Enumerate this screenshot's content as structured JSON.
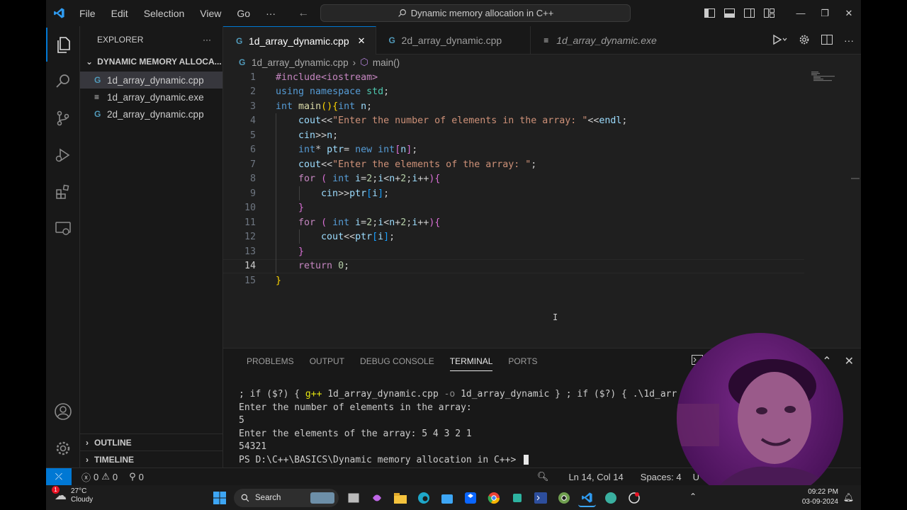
{
  "menu": [
    "File",
    "Edit",
    "Selection",
    "View",
    "Go",
    "···"
  ],
  "command_center": "Dynamic memory allocation in C++",
  "sidebar": {
    "title": "EXPLORER",
    "more": "···",
    "folder": "DYNAMIC MEMORY ALLOCA...",
    "files": [
      "1d_array_dynamic.cpp",
      "1d_array_dynamic.exe",
      "2d_array_dynamic.cpp"
    ],
    "outline": "OUTLINE",
    "timeline": "TIMELINE"
  },
  "tabs": [
    {
      "label": "1d_array_dynamic.cpp",
      "close": "✕"
    },
    {
      "label": "2d_array_dynamic.cpp"
    },
    {
      "label": "1d_array_dynamic.exe"
    }
  ],
  "breadcrumb": {
    "file": "1d_array_dynamic.cpp",
    "symbol": "main()"
  },
  "code_lines": [
    {
      "n": "1"
    },
    {
      "n": "2"
    },
    {
      "n": "3"
    },
    {
      "n": "4"
    },
    {
      "n": "5"
    },
    {
      "n": "6"
    },
    {
      "n": "7"
    },
    {
      "n": "8"
    },
    {
      "n": "9"
    },
    {
      "n": "10"
    },
    {
      "n": "11"
    },
    {
      "n": "12"
    },
    {
      "n": "13"
    },
    {
      "n": "14"
    },
    {
      "n": "15"
    }
  ],
  "code": {
    "l1": "#include<iostream>",
    "l2a": "using",
    "l2b": "namespace",
    "l2c": "std",
    "l3a": "int",
    "l3b": "main",
    "l3c": "int",
    "l3d": "n",
    "l4a": "cout",
    "l4b": "\"Enter the number of elements in the array: \"",
    "l4c": "endl",
    "l5a": "cin",
    "l5b": "n",
    "l6a": "int",
    "l6b": "ptr",
    "l6c": "new",
    "l6d": "int",
    "l6e": "n",
    "l7a": "cout",
    "l7b": "\"Enter the elements of the array: \"",
    "l8a": "for",
    "l8b": "int",
    "l8c": "i",
    "l8d": "2",
    "l8e": "i",
    "l8f": "n",
    "l8g": "2",
    "l8h": "i",
    "l9a": "cin",
    "l9b": "ptr",
    "l9c": "i",
    "l11a": "for",
    "l11b": "int",
    "l11c": "i",
    "l11d": "2",
    "l11e": "i",
    "l11f": "n",
    "l11g": "2",
    "l11h": "i",
    "l12a": "cout",
    "l12b": "ptr",
    "l12c": "i",
    "l14a": "return",
    "l14b": "0"
  },
  "panel": {
    "tabs": [
      "PROBLEMS",
      "OUTPUT",
      "DEBUG CONSOLE",
      "TERMINAL",
      "PORTS"
    ],
    "terminal_lines": {
      "cmd1": "; if ($?) { ",
      "cmd2": "g++",
      "cmd3": " 1d_array_dynamic.cpp ",
      "cmd4": "-o",
      "cmd5": " 1d_array_dynamic } ; if ($?) { .\\1d_arr",
      "o1": "Enter the number of elements in the array:",
      "o2": "5",
      "o3": "Enter the elements of the array: 5 4 3 2 1",
      "o4": "54321",
      "prompt": "PS D:\\C++\\BASICS\\Dynamic memory allocation in C++> "
    }
  },
  "status": {
    "errors": "0",
    "warnings": "0",
    "ports": "0",
    "position": "Ln 14, Col 14",
    "spaces": "Spaces: 4",
    "encoding": "U"
  },
  "taskbar": {
    "temp": "27°C",
    "weather": "Cloudy",
    "badge": "1",
    "search": "Search",
    "time": "09:22 PM",
    "date": "03-09-2024"
  },
  "colors": {
    "accent": "#0078d4",
    "editor_bg": "#1f1f1f",
    "chrome_bg": "#181818"
  }
}
